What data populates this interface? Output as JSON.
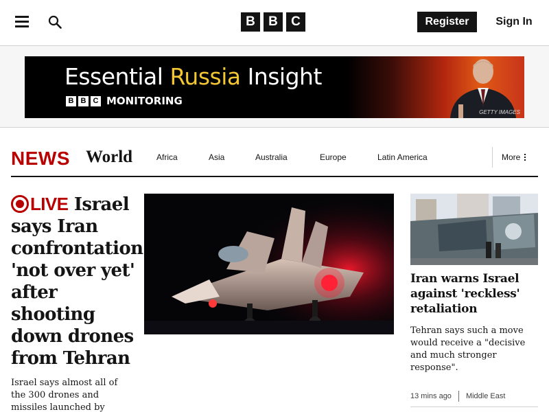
{
  "header": {
    "menu_icon": "hamburger-menu-icon",
    "search_icon": "search-icon",
    "logo_letters": [
      "B",
      "B",
      "C"
    ],
    "register_label": "Register",
    "signin_label": "Sign In"
  },
  "ad": {
    "title_part1": "Essential ",
    "title_highlight": "Russia",
    "title_part2": " Insight",
    "mini_logo": [
      "B",
      "B",
      "C"
    ],
    "subtitle": "MONITORING",
    "credit": "GETTY IMAGES",
    "highlight_color": "#f3c633"
  },
  "nav": {
    "brand": "NEWS",
    "section": "World",
    "items": [
      "Africa",
      "Asia",
      "Australia",
      "Europe",
      "Latin America"
    ],
    "more_label": "More",
    "brand_color": "#b80000"
  },
  "lead": {
    "live_label": "LIVE",
    "headline": "Israel says Iran confrontation 'not over yet' after shooting down drones from Tehran",
    "summary": "Israel says almost all of the 300 drones and missiles launched by"
  },
  "side": {
    "headline": "Iran warns Israel against 'reckless' retaliation",
    "summary": "Tehran says such a move would receive a \"decisive and much stronger response\".",
    "time": "13 mins ago",
    "category": "Middle East"
  }
}
